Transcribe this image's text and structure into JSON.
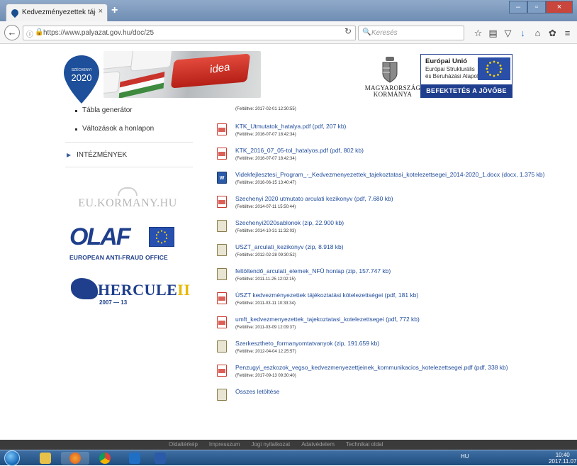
{
  "browser": {
    "tab_title": "Kedvezményezettek tájékozta",
    "tab_close": "×",
    "new_tab": "+",
    "url": "https://www.palyazat.gov.hu/doc/25",
    "search_placeholder": "Keresés",
    "window_controls": [
      "–",
      "▫",
      "×"
    ]
  },
  "header": {
    "logo_2020_top": "SZÉCHENYI",
    "logo_2020_year": "2020",
    "banner_word": "idea",
    "gov_line1": "MAGYARORSZÁG",
    "gov_line2": "KORMÁNYA",
    "eu_title": "Európai Unió",
    "eu_sub1": "Európai Strukturális",
    "eu_sub2": "és Beruházási Alapok",
    "eu_slogan": "BEFEKTETÉS A JÖVŐBE"
  },
  "leftnav": {
    "subitems": [
      "Tábla generátor",
      "Változások a honlapon"
    ],
    "sections": [
      "INTÉZMÉNYEK"
    ]
  },
  "partners": {
    "eukormany": "EU.KORMANY.HU",
    "olaf_word": "OLAF",
    "olaf_sub": "EUROPEAN ANTI-FRAUD OFFICE",
    "hercule_word": "HERCULE",
    "hercule_roman": "II",
    "hercule_years": "2007 — 13"
  },
  "files": [
    {
      "type": "pdf",
      "name": "KTK_Utmutatok_hatalya.pdf (pdf, 207 kb)",
      "date": "(Feltöltve: 2016-07-07 18:42:34)"
    },
    {
      "type": "pdf",
      "name": "KTK_2016_07_05-tol_hatalyos.pdf (pdf, 802 kb)",
      "date": "(Feltöltve: 2016-07-07 18:42:34)"
    },
    {
      "type": "doc",
      "name": "Videkfejlesztesi_Program_-_Kedvezmenyezettek_tajekoztatasi_kotelezettsegei_2014-2020_1.docx (docx, 1.375 kb)",
      "date": "(Feltöltve: 2016-06-15 13:40:47)"
    },
    {
      "type": "pdf",
      "name": "Szechenyi 2020 utmutato arculati kezikonyv (pdf, 7.680 kb)",
      "date": "(Feltöltve: 2014-07-11 15:50:44)"
    },
    {
      "type": "zip",
      "name": "Szechenyi2020sablonok (zip, 22.900 kb)",
      "date": "(Feltöltve: 2014-10-31 11:32:03)"
    },
    {
      "type": "zip",
      "name": "USZT_arculati_kezikonyv (zip, 8.918 kb)",
      "date": "(Feltöltve: 2012-02-28 09:30:52)"
    },
    {
      "type": "zip",
      "name": "feltöltendő_arculati_elemek_NFÜ honlap (zip, 157.747 kb)",
      "date": "(Feltöltve: 2011-11-25 12:02:15)"
    },
    {
      "type": "pdf",
      "name": "ÚSZT kedvezményezettek tájékoztatási kötelezettségei (pdf, 181 kb)",
      "date": "(Feltöltve: 2011-03-11 10:33:34)"
    },
    {
      "type": "pdf",
      "name": "umft_kedvezmenyezettek_tajekoztatasi_kotelezettsegei (pdf, 772 kb)",
      "date": "(Feltöltve: 2011-03-09 12:09:37)"
    },
    {
      "type": "zip",
      "name": "Szerkesztheto_formanyomtatvanyok (zip, 191.659 kb)",
      "date": "(Feltöltve: 2012-04-04 12:25:57)"
    },
    {
      "type": "pdf",
      "name": "Penzugyi_eszkozok_vegso_kedvezmenyezettjeinek_kommunikacios_kotelezettsegei.pdf (pdf, 338 kb)",
      "date": "(Feltöltve: 2017-09-13 09:30:40)"
    },
    {
      "type": "zip",
      "name": "Összes letöltése",
      "date": ""
    }
  ],
  "partial_date": "(Feltöltve: 2017-02-01 12:30:55)",
  "footer": {
    "links": [
      "Oldaltérkép",
      "Impresszum",
      "Jogi nyilatkozat",
      "Adatvédelem",
      "Technikai oldal"
    ]
  },
  "taskbar": {
    "tray_lang": "HU",
    "clock_time": "10:40",
    "clock_date": "2017.11.07"
  },
  "colors": {
    "link": "#1f4b9b",
    "eu_blue": "#1f3e8e",
    "accent_red": "#c93b2f"
  }
}
